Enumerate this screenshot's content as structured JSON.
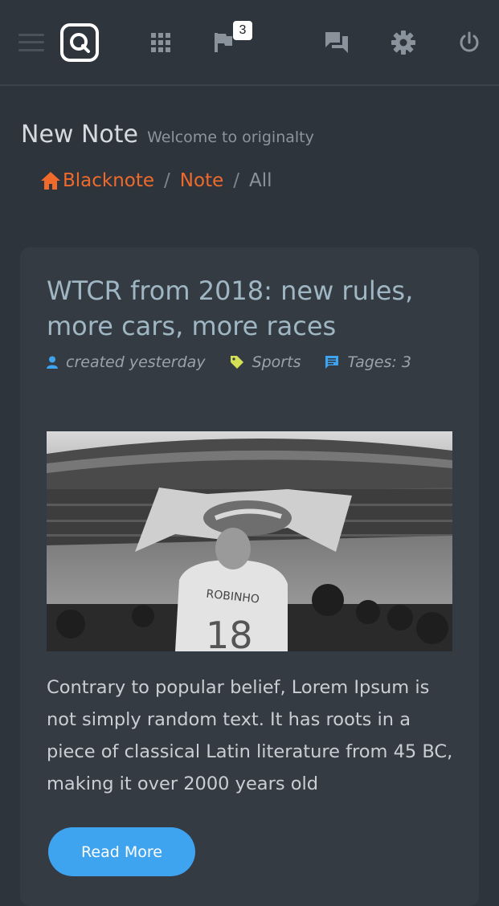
{
  "header": {
    "notifications_count": "3",
    "icons": [
      "menu-icon",
      "logo-icon",
      "apps-grid-icon",
      "flag-icon",
      "chat-icon",
      "gear-icon",
      "power-icon"
    ]
  },
  "page": {
    "title": "New Note",
    "subtitle": "Welcome to originalty"
  },
  "breadcrumb": {
    "items": [
      "Blacknote",
      "Note",
      "All"
    ],
    "separator": "/"
  },
  "post": {
    "title": "WTCR from 2018: new rules, more cars, more races",
    "meta": {
      "created": "created yesterday",
      "category": "Sports",
      "tags": "Tages: 3"
    },
    "body": "Contrary to popular belief, Lorem Ipsum is not simply random text. It has roots in a piece of classical Latin literature from 45 BC, making it over 2000 years old",
    "read_more_label": "Read More"
  },
  "colors": {
    "background": "#2e343c",
    "card": "#353b43",
    "accent_orange": "#f06a2b",
    "accent_blue": "#3fa4f0",
    "tag_yellow": "#d4e157"
  }
}
